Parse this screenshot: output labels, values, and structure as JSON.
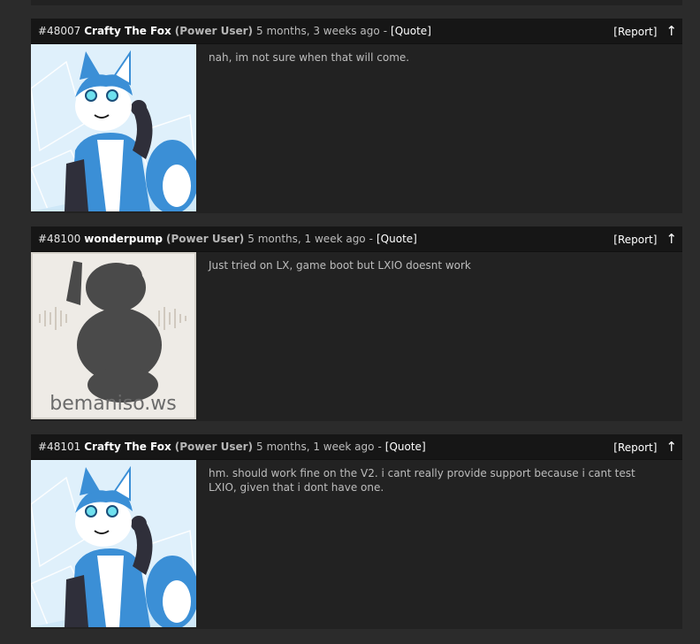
{
  "posts": [
    {
      "number": "#48007",
      "author": "Crafty The Fox",
      "role": "(Power User)",
      "time": "5 months, 3 weeks ago",
      "separator": "-",
      "quote_label": "[Quote]",
      "report_label": "[Report]",
      "up_arrow": "↑",
      "message": "nah, im not sure when that will come.",
      "avatar": "fox-avatar"
    },
    {
      "number": "#48100",
      "author": "wonderpump",
      "role": "(Power User)",
      "time": "5 months, 1 week ago",
      "separator": "-",
      "quote_label": "[Quote]",
      "report_label": "[Report]",
      "up_arrow": "↑",
      "message": "Just tried on LX, game boot but LXIO doesnt work",
      "avatar": "default-avatar",
      "avatar_text": "bemaniso.ws"
    },
    {
      "number": "#48101",
      "author": "Crafty The Fox",
      "role": "(Power User)",
      "time": "5 months, 1 week ago",
      "separator": "-",
      "quote_label": "[Quote]",
      "report_label": "[Report]",
      "up_arrow": "↑",
      "message": "hm. should work fine on the V2. i cant really provide support because i cant test LXIO, given that i dont have one.",
      "avatar": "fox-avatar"
    }
  ],
  "colors": {
    "page_bg": "#2b2b2b",
    "post_bg": "#222222",
    "header_bg": "#161616",
    "fox_blue": "#3b8fd6"
  }
}
